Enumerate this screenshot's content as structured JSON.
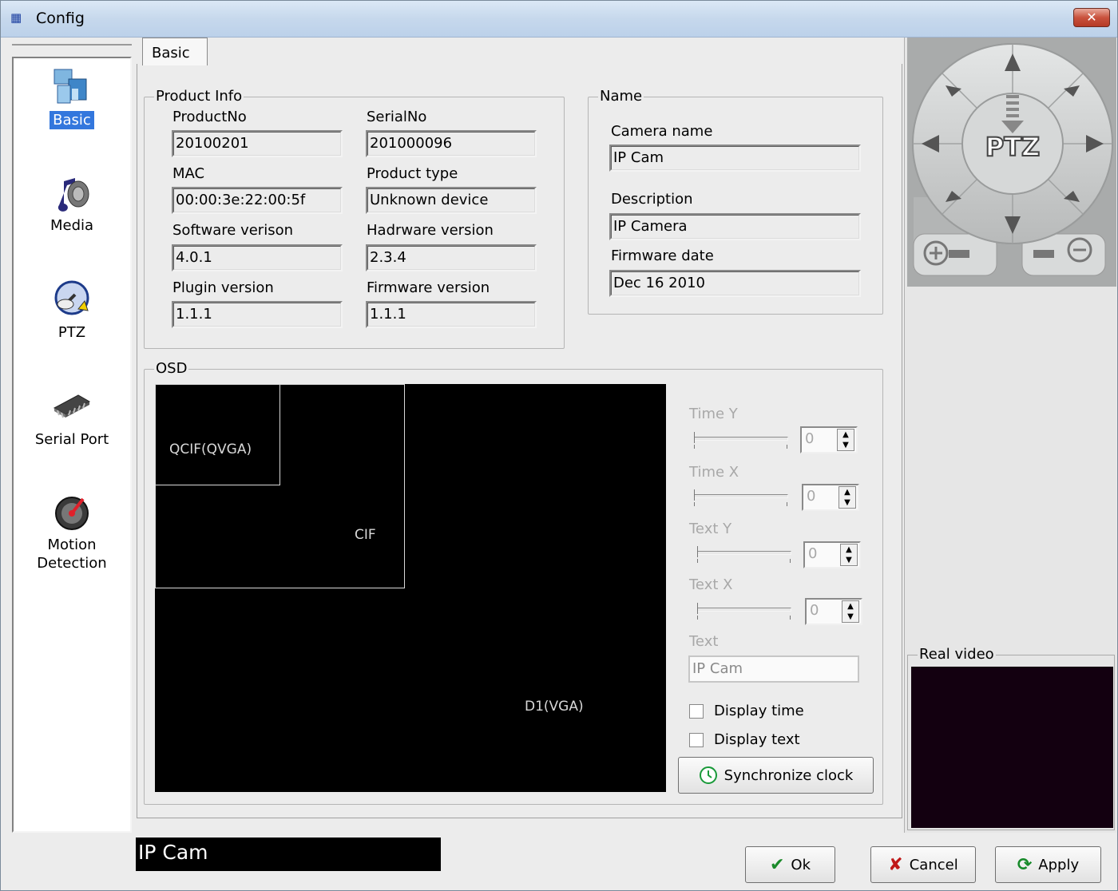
{
  "window": {
    "title": "Config",
    "app_icon_glyph": "▦",
    "close_glyph": "✕"
  },
  "sidebar": {
    "items": [
      {
        "label": "Basic",
        "icon": "network-icon",
        "active": true
      },
      {
        "label": "Media",
        "icon": "media-icon",
        "active": false
      },
      {
        "label": "PTZ",
        "icon": "ptz-icon",
        "active": false
      },
      {
        "label": "Serial Port",
        "icon": "chip-icon",
        "active": false
      },
      {
        "label": "Motion\nDetection",
        "icon": "motion-detection-icon",
        "active": false
      }
    ]
  },
  "tabs": [
    {
      "label": "Basic"
    }
  ],
  "product_info": {
    "legend": "Product Info",
    "product_no_label": "ProductNo",
    "product_no": "20100201",
    "serial_no_label": "SerialNo",
    "serial_no": "201000096",
    "mac_label": "MAC",
    "mac": "00:00:3e:22:00:5f",
    "product_type_label": "Product type",
    "product_type": "Unknown device",
    "software_version_label": "Software verison",
    "software_version": "4.0.1",
    "hardware_version_label": "Hadrware version",
    "hardware_version": "2.3.4",
    "plugin_version_label": "Plugin version",
    "plugin_version": "1.1.1",
    "firmware_version_label": "Firmware version",
    "firmware_version": "1.1.1"
  },
  "name_group": {
    "legend": "Name",
    "camera_name_label": "Camera name",
    "camera_name": "IP Cam",
    "description_label": "Description",
    "description": "IP Camera",
    "firmware_date_label": "Firmware date",
    "firmware_date": "Dec 16 2010"
  },
  "osd": {
    "legend": "OSD",
    "qcif_label": "QCIF(QVGA)",
    "cif_label": "CIF",
    "d1_label": "D1(VGA)",
    "time_y_label": "Time Y",
    "time_y": "0",
    "time_x_label": "Time X",
    "time_x": "0",
    "text_y_label": "Text Y",
    "text_y": "0",
    "text_x_label": "Text X",
    "text_x": "0",
    "text_label": "Text",
    "text_value": "IP Cam",
    "display_time_label": "Display time",
    "display_time_checked": false,
    "display_text_label": "Display text",
    "display_text_checked": false,
    "sync_clock_label": "Synchronize clock"
  },
  "ptz_panel": {
    "center_label": "PTZ"
  },
  "real_video": {
    "legend": "Real video"
  },
  "status": {
    "camera": "IP Cam"
  },
  "footer": {
    "ok_label": "Ok",
    "cancel_label": "Cancel",
    "apply_label": "Apply"
  },
  "colors": {
    "accent": "#3377dd",
    "video_bg": "#130010"
  }
}
